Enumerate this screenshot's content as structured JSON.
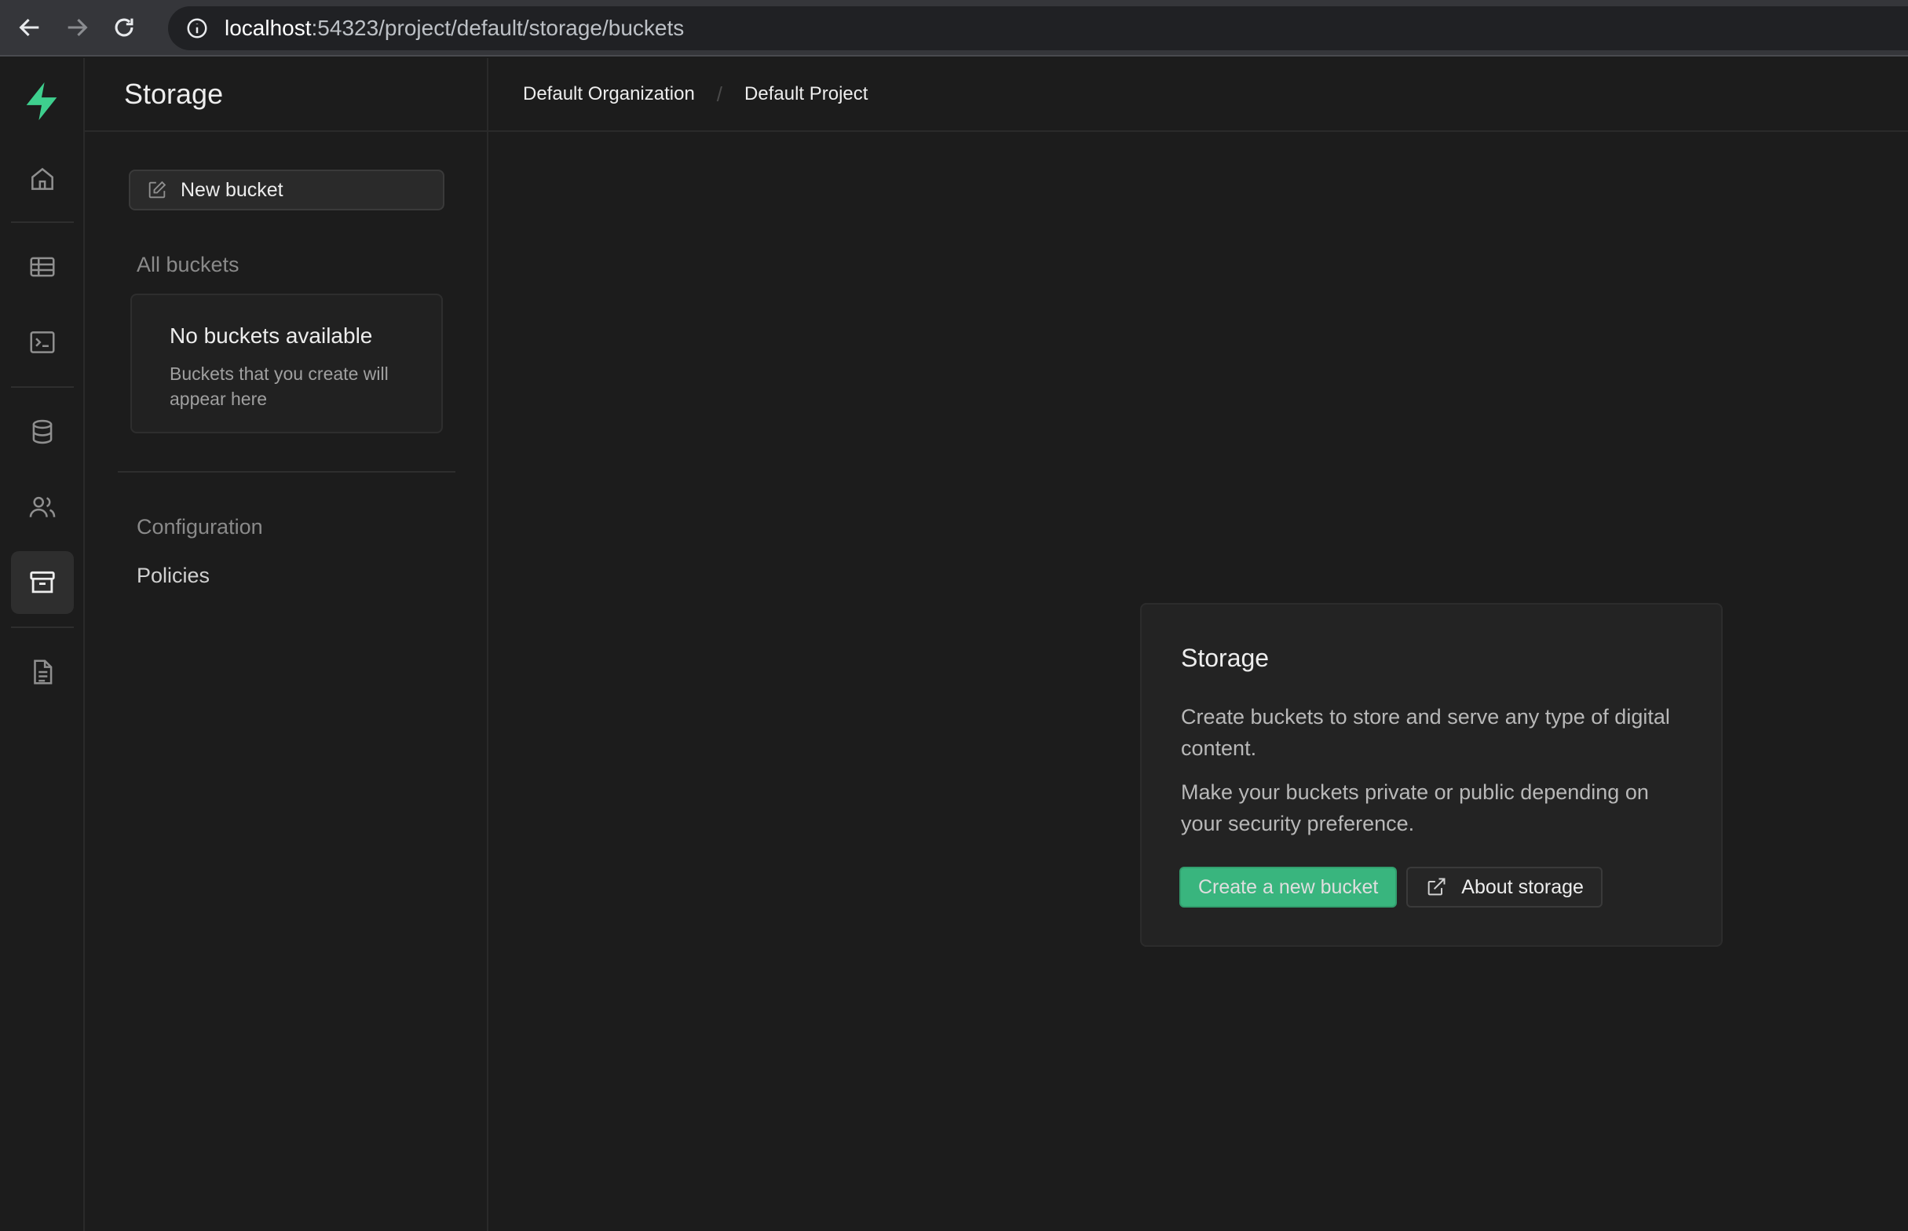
{
  "browser": {
    "url_host": "localhost",
    "url_path": ":54323/project/default/storage/buckets"
  },
  "rail": {
    "items": [
      {
        "icon": "home-icon"
      },
      {
        "icon": "table-editor-icon"
      },
      {
        "icon": "sql-editor-icon"
      },
      {
        "icon": "database-icon"
      },
      {
        "icon": "users-icon"
      },
      {
        "icon": "storage-icon",
        "active": true
      },
      {
        "icon": "docs-icon"
      }
    ]
  },
  "sidebar": {
    "title": "Storage",
    "new_bucket_label": "New bucket",
    "all_buckets_label": "All buckets",
    "empty_title": "No buckets available",
    "empty_desc": "Buckets that you create will appear here",
    "configuration_label": "Configuration",
    "policies_label": "Policies"
  },
  "breadcrumb": {
    "organization": "Default Organization",
    "separator": "/",
    "project": "Default Project"
  },
  "card": {
    "title": "Storage",
    "text1": "Create buckets to store and serve any type of digital content.",
    "text2": "Make your buckets private or public depending on your security preference.",
    "primary_label": "Create a new bucket",
    "secondary_label": "About storage"
  },
  "colors": {
    "accent": "#3ecf8e",
    "background": "#1c1c1c"
  }
}
